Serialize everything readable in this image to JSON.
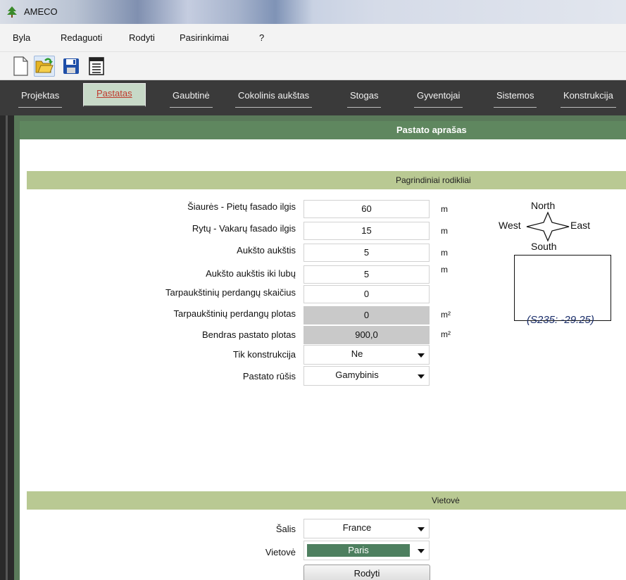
{
  "window": {
    "title": "AMECO",
    "icon": "tree-icon"
  },
  "menu": [
    "Byla",
    "Redaguoti",
    "Rodyti",
    "Pasirinkimai",
    "?"
  ],
  "toolbar": [
    {
      "name": "new-file-icon"
    },
    {
      "name": "open-folder-icon"
    },
    {
      "name": "save-icon"
    },
    {
      "name": "report-icon"
    }
  ],
  "tabs": [
    "Projektas",
    "Pastatas",
    "Gaubtinė",
    "Cokolinis aukštas",
    "Stogas",
    "Gyventojai",
    "Sistemos",
    "Konstrukcija"
  ],
  "active_tab": "Pastatas",
  "panel": {
    "title": "Pastato aprašas"
  },
  "sections": {
    "main": "Pagrindiniai rodikliai",
    "location": "Vietovė"
  },
  "fields": [
    {
      "label": "Šiaurės - Pietų fasado ilgis",
      "value": "60",
      "unit": "m",
      "readonly": false
    },
    {
      "label": "Rytų - Vakarų fasado ilgis",
      "value": "15",
      "unit": "m",
      "readonly": false
    },
    {
      "label": "Aukšto aukštis",
      "value": "5",
      "unit": "m",
      "readonly": false
    },
    {
      "label": "Aukšto aukštis iki lubų",
      "value": "5",
      "unit": "m",
      "readonly": false
    },
    {
      "label": "Tarpaukštinių perdangų skaičius",
      "value": "0",
      "unit": "",
      "readonly": false
    },
    {
      "label": "Tarpaukštinių perdangų plotas",
      "value": "0",
      "unit": "m²",
      "readonly": true
    },
    {
      "label": "Bendras pastato plotas",
      "value": "900,0",
      "unit": "m²",
      "readonly": true
    }
  ],
  "selects": [
    {
      "label": "Tik konstrukcija",
      "value": "Ne"
    },
    {
      "label": "Pastato rūšis",
      "value": "Gamybinis"
    }
  ],
  "compass": {
    "north": "North",
    "south": "South",
    "east": "East",
    "west": "West"
  },
  "plan_coords": "(S235: -29.25)",
  "location": {
    "country_label": "Šalis",
    "country_value": "France",
    "place_label": "Vietovė",
    "place_value": "Paris",
    "show_button": "Rodyti"
  },
  "colors": {
    "panel_header": "#5f875f",
    "section_bar": "#b9c993",
    "active_tab_text": "#c0392b",
    "selected_place": "#4d7f5f"
  }
}
